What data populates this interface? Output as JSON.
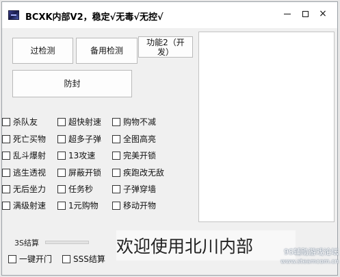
{
  "window": {
    "title": "BCXK内部V2，稳定√无毒√无控√",
    "controls": {
      "minimize": "minimize",
      "maximize": "maximize",
      "close": "×"
    }
  },
  "buttons": {
    "pass_check": "过检测",
    "backup_check": "备用检测",
    "feature2": "功能2（开发）",
    "anti_ban": "防封"
  },
  "checkboxes": {
    "col1": [
      "杀队友",
      "死亡买物",
      "乱斗爆射",
      "逃生透视",
      "无后坐力",
      "满级射速"
    ],
    "col2": [
      "超快射速",
      "超多子弹",
      "13攻速",
      "屏蔽开锁",
      "任务秒",
      "1元购物"
    ],
    "col3": [
      "购物不减",
      "全图高亮",
      "完美开锁",
      "疾跑改无敌",
      "子弹穿墙",
      "移动开物"
    ]
  },
  "bottom": {
    "group_label": "3S结算",
    "one_key_open": "一键开门",
    "sss_settle": "SSS结算"
  },
  "banner": "欢迎使用北川内部",
  "watermark": {
    "site": "9S辅助游戏论坛",
    "url": "www.steamcom.cn"
  }
}
